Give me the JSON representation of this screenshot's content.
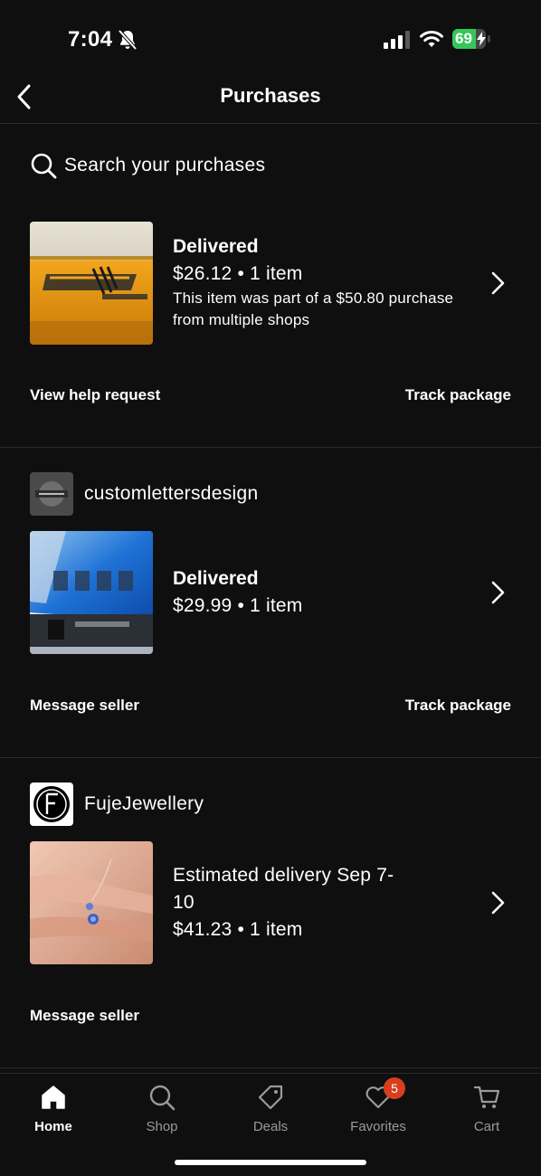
{
  "status_bar": {
    "time": "7:04",
    "battery_level": "69",
    "battery_percent": 69,
    "icons": [
      "bell-slash-icon",
      "cellular-signal-icon",
      "wifi-icon",
      "battery-charging-icon"
    ]
  },
  "header": {
    "title": "Purchases",
    "back_icon": "chevron-left-icon"
  },
  "search": {
    "placeholder": "Search your purchases",
    "icon": "search-icon"
  },
  "purchases": [
    {
      "shop_name": "",
      "status": "Delivered",
      "price_line": "$26.12 • 1 item",
      "note": "This item was part of a $50.80 purchase from multiple shops",
      "actions": [
        "View help request",
        "Track package"
      ]
    },
    {
      "shop_name": "customlettersdesign",
      "status": "Delivered",
      "price_line": "$29.99 • 1 item",
      "note": "",
      "actions": [
        "Message seller",
        "Track package"
      ]
    },
    {
      "shop_name": "FujeJewellery",
      "status": "Estimated delivery Sep 7-10",
      "price_line": "$41.23 • 1 item",
      "note": "",
      "actions": [
        "Message seller"
      ]
    }
  ],
  "bottom_nav": {
    "items": [
      {
        "label": "Home",
        "icon": "home-icon",
        "active": true
      },
      {
        "label": "Shop",
        "icon": "search-icon",
        "active": false
      },
      {
        "label": "Deals",
        "icon": "tag-icon",
        "active": false
      },
      {
        "label": "Favorites",
        "icon": "heart-icon",
        "active": false,
        "badge": "5"
      },
      {
        "label": "Cart",
        "icon": "cart-icon",
        "active": false
      }
    ]
  },
  "colors": {
    "background": "#0f0f0f",
    "text": "#ffffff",
    "muted": "#9a9a9a",
    "badge": "#d83e1e",
    "battery": "#34c759"
  }
}
